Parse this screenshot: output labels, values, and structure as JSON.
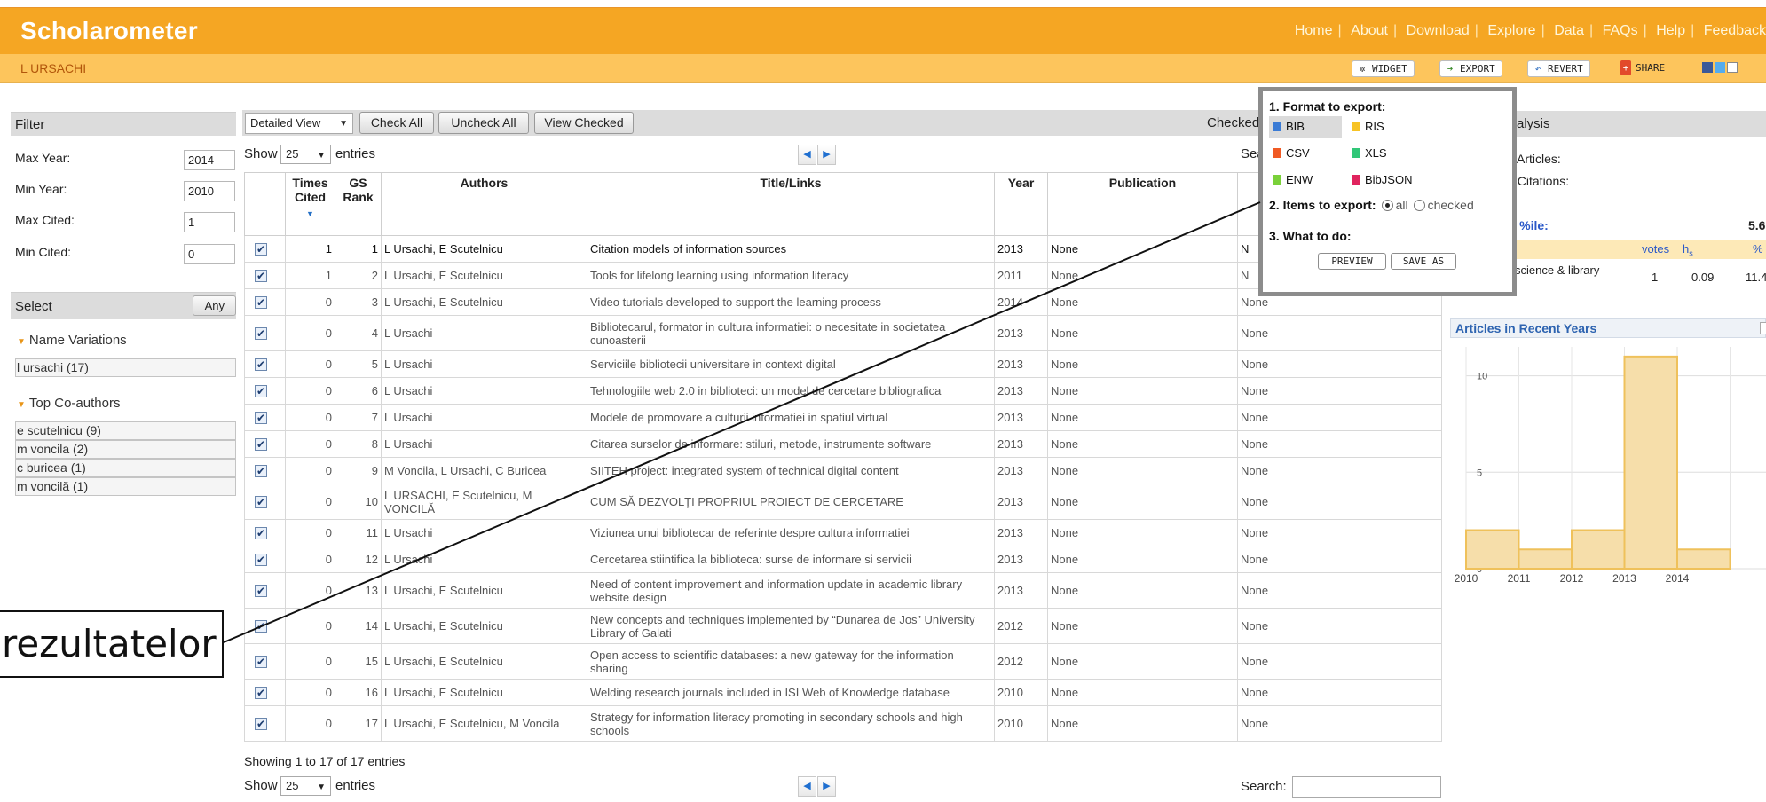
{
  "app": {
    "brand": "Scholarometer",
    "nav": [
      "Home",
      "About",
      "Download",
      "Explore",
      "Data",
      "FAQs",
      "Help",
      "Feedback"
    ],
    "author_name": "L URSACHI",
    "toolbar": {
      "widget": "WIDGET",
      "export": "EXPORT",
      "revert": "REVERT",
      "share": "SHARE"
    }
  },
  "filter": {
    "title": "Filter",
    "fields": [
      {
        "label": "Max Year:",
        "value": "2014"
      },
      {
        "label": "Min Year:",
        "value": "2010"
      },
      {
        "label": "Max Cited:",
        "value": "1"
      },
      {
        "label": "Min Cited:",
        "value": "0"
      }
    ]
  },
  "select": {
    "title": "Select",
    "any_label": "Any",
    "name_variations_title": "Name Variations",
    "name_variations": [
      "l ursachi (17)"
    ],
    "coauthors_title": "Top Co-authors",
    "coauthors": [
      "e scutelnicu (9)",
      "m voncila (2)",
      "c buricea (1)",
      "m voncilă (1)"
    ]
  },
  "controls": {
    "view_select": "Detailed View",
    "check_all": "Check All",
    "uncheck_all": "Uncheck All",
    "view_checked": "View Checked",
    "checked_label": "Checked",
    "show_label": "Show",
    "entries_value": "25",
    "entries_label": "entries",
    "search_label_partial": "Sea",
    "search_label": "Search:",
    "summary": "Showing 1 to 17 of 17 entries"
  },
  "table": {
    "columns": {
      "times_cited": "Times Cited",
      "gs_rank": "GS Rank",
      "authors": "Authors",
      "title": "Title/Links",
      "year": "Year",
      "publication": "Publication"
    },
    "rows": [
      {
        "cited": "1",
        "rank": "1",
        "authors": "L Ursachi, E Scutelnicu",
        "title": "Citation models of information sources",
        "year": "2013",
        "pub": "None",
        "extra": "N"
      },
      {
        "cited": "1",
        "rank": "2",
        "authors": "L Ursachi, E Scutelnicu",
        "title": "Tools for lifelong learning using information literacy",
        "year": "2011",
        "pub": "None",
        "extra": "N"
      },
      {
        "cited": "0",
        "rank": "3",
        "authors": "L Ursachi, E Scutelnicu",
        "title": "Video tutorials developed to support the learning process",
        "year": "2014",
        "pub": "None",
        "extra": "None"
      },
      {
        "cited": "0",
        "rank": "4",
        "authors": "L Ursachi",
        "title": "Bibliotecarul, formator in cultura informatiei: o necesitate in societatea cunoasterii",
        "year": "2013",
        "pub": "None",
        "extra": "None"
      },
      {
        "cited": "0",
        "rank": "5",
        "authors": "L Ursachi",
        "title": "Serviciile bibliotecii universitare in context digital",
        "year": "2013",
        "pub": "None",
        "extra": "None"
      },
      {
        "cited": "0",
        "rank": "6",
        "authors": "L Ursachi",
        "title": "Tehnologiile web 2.0 in biblioteci: un model de cercetare bibliografica",
        "year": "2013",
        "pub": "None",
        "extra": "None"
      },
      {
        "cited": "0",
        "rank": "7",
        "authors": "L Ursachi",
        "title": "Modele de promovare a culturii informatiei in spatiul virtual",
        "year": "2013",
        "pub": "None",
        "extra": "None"
      },
      {
        "cited": "0",
        "rank": "8",
        "authors": "L Ursachi",
        "title": "Citarea surselor de informare: stiluri, metode, instrumente software",
        "year": "2013",
        "pub": "None",
        "extra": "None"
      },
      {
        "cited": "0",
        "rank": "9",
        "authors": "M Voncila, L Ursachi, C Buricea",
        "title": "SIITEH project: integrated system of technical digital content",
        "year": "2013",
        "pub": "None",
        "extra": "None"
      },
      {
        "cited": "0",
        "rank": "10",
        "authors": "L URSACHI, E Scutelnicu, M VONCILĂ",
        "title": "CUM SĂ DEZVOLŢI PROPRIUL PROIECT DE CERCETARE",
        "year": "2013",
        "pub": "None",
        "extra": "None"
      },
      {
        "cited": "0",
        "rank": "11",
        "authors": "L Ursachi",
        "title": "Viziunea unui bibliotecar de referinte despre cultura informatiei",
        "year": "2013",
        "pub": "None",
        "extra": "None"
      },
      {
        "cited": "0",
        "rank": "12",
        "authors": "L Ursachi",
        "title": "Cercetarea stiintifica la biblioteca: surse de informare si servicii",
        "year": "2013",
        "pub": "None",
        "extra": "None"
      },
      {
        "cited": "0",
        "rank": "13",
        "authors": "L Ursachi, E Scutelnicu",
        "title": "Need of content improvement and information update in academic library website design",
        "year": "2013",
        "pub": "None",
        "extra": "None"
      },
      {
        "cited": "0",
        "rank": "14",
        "authors": "L Ursachi, E Scutelnicu",
        "title": "New concepts and techniques implemented by “Dunarea de Jos” University Library of Galati",
        "year": "2012",
        "pub": "None",
        "extra": "None"
      },
      {
        "cited": "0",
        "rank": "15",
        "authors": "L Ursachi, E Scutelnicu",
        "title": "Open access to scientific databases: a new gateway for the information sharing",
        "year": "2012",
        "pub": "None",
        "extra": "None"
      },
      {
        "cited": "0",
        "rank": "16",
        "authors": "L Ursachi, E Scutelnicu",
        "title": "Welding research journals included in ISI Web of Knowledge database",
        "year": "2010",
        "pub": "None",
        "extra": "None"
      },
      {
        "cited": "0",
        "rank": "17",
        "authors": "L Ursachi, E Scutelnicu, M Voncila",
        "title": "Strategy for information literacy promoting in secondary schools and high schools",
        "year": "2010",
        "pub": "None",
        "extra": "None"
      }
    ]
  },
  "analysis": {
    "title_partial": "alysis",
    "articles_label": "f Articles:",
    "citations_label": "f Citations:",
    "percentile_label": "neter %ile:",
    "percentile_value": "5.6",
    "cols": {
      "votes": "votes",
      "hs": "h",
      "hs_sub": "s",
      "pct": "%"
    },
    "row": {
      "field": "science & library",
      "votes": "1",
      "hs": "0.09",
      "pct": "11.4"
    }
  },
  "chart_data": {
    "type": "bar",
    "title": "Articles in Recent Years",
    "categories": [
      "2010",
      "2011",
      "2012",
      "2013",
      "2014"
    ],
    "values": [
      2,
      1,
      2,
      11,
      1
    ],
    "ylim": [
      0,
      11.5
    ],
    "yticks": [
      0,
      5,
      10
    ],
    "xticks": [
      "2010",
      "2011",
      "2012",
      "2013",
      "2014"
    ],
    "bar_color": "#f6deaa",
    "bar_stroke": "#efc15b",
    "grid": true
  },
  "export_popup": {
    "step1": "1. Format to export:",
    "formats": [
      {
        "name": "BIB",
        "color": "#3a7bd5",
        "selected": true
      },
      {
        "name": "RIS",
        "color": "#f7c325",
        "selected": false
      },
      {
        "name": "CSV",
        "color": "#f05a24",
        "selected": false
      },
      {
        "name": "XLS",
        "color": "#31c778",
        "selected": false
      },
      {
        "name": "ENW",
        "color": "#7ad13a",
        "selected": false
      },
      {
        "name": "BibJSON",
        "color": "#e0245e",
        "selected": false
      }
    ],
    "step2": "2. Items to export:",
    "opt_all": "all",
    "opt_checked": "checked",
    "step3": "3. What to do:",
    "preview": "PREVIEW",
    "save_as": "SAVE AS"
  },
  "annotation": {
    "text": "rezultatelor"
  }
}
